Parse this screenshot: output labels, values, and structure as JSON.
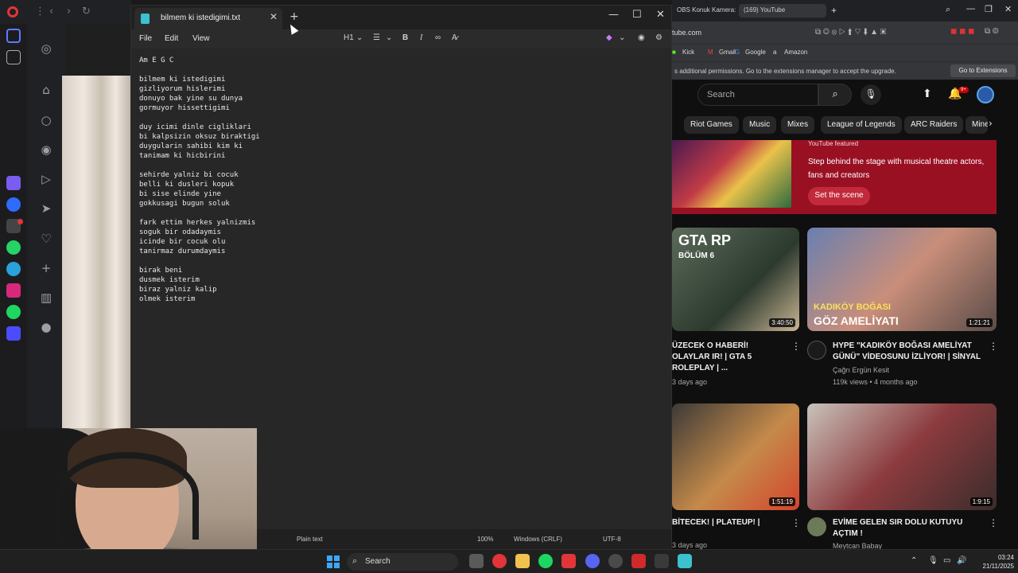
{
  "notepad": {
    "tab_title": "bilmem ki istedigimi.txt",
    "menu": {
      "file": "File",
      "edit": "Edit",
      "view": "View"
    },
    "toolbar": {
      "heading": "H1",
      "list_icon": "list-icon",
      "bold": "B",
      "italic": "I"
    },
    "lines": [
      "Am E G C",
      "",
      "bilmem ki istedigimi",
      "gizliyorum hislerimi",
      "donuyo bak yine su dunya",
      "gormuyor hissettigimi",
      "",
      "duy icimi dinle cigliklari",
      "bi kalpsizin oksuz biraktigi",
      "duygularin sahibi kim ki",
      "tanimam ki hicbirini",
      "",
      "sehirde yalniz bi cocuk",
      "belli ki dusleri kopuk",
      "bi sise elinde yine",
      "gokkusagi bugun soluk",
      "",
      "fark ettim herkes yalnizmis",
      "soguk bir odadaymis",
      "icinde bir cocuk olu",
      "tanirmaz durumdaymis",
      "",
      "birak beni",
      "dusmek isterim",
      "biraz yalniz kalip",
      "olmek isterim"
    ],
    "status": {
      "format": "Plain text",
      "zoom": "100%",
      "line_ending": "Windows (CRLF)",
      "encoding": "UTF-8"
    }
  },
  "browser": {
    "tabs": [
      "OBS Konuk Kamera:",
      "(169) YouTube"
    ],
    "address": "tube.com",
    "bookmarks": [
      "Kick",
      "Gmail",
      "Google",
      "Amazon"
    ],
    "infobar_text": "s additional permissions. Go to the extensions manager to accept the upgrade.",
    "infobar_button": "Go to Extensions"
  },
  "youtube": {
    "search_placeholder": "Search",
    "notif_badge": "9+",
    "chips": [
      "Riot Games",
      "Music",
      "Mixes",
      "League of Legends",
      "ARC Raiders",
      "Mine"
    ],
    "featured": {
      "label": "YouTube featured",
      "desc": "Step behind the stage with musical theatre actors, fans and creators",
      "button": "Set the scene"
    },
    "videos": [
      {
        "overlay1": "GTA RP",
        "overlay2": "BÖLÜM 6",
        "duration": "3:40:50",
        "title": "ÜZECEK O HABERİ! OLAYLAR IR! | GTA 5 ROLEPLAY | ...",
        "channel": "",
        "meta": "3 days ago"
      },
      {
        "overlay1": "KADIKÖY BOĞASI",
        "overlay2": "GÖZ AMELİYATI",
        "duration": "1:21:21",
        "title": "HYPE \"KADIKÖY BOĞASI AMELİYAT GÜNÜ\" VİDEOSUNU İZLİYOR! | SİNYAL",
        "channel": "Çağrı Ergün Kesit",
        "meta": "119k views • 4 months ago"
      },
      {
        "overlay1": "",
        "overlay2": "",
        "duration": "1:51:19",
        "title": "BİTECEK! | PLATEUP! |",
        "channel": "",
        "meta": "3 days ago"
      },
      {
        "overlay1": "",
        "overlay2": "",
        "duration": "1:9:15",
        "title": "EVİME GELEN SIR DOLU KUTUYU AÇTIM !",
        "channel": "Meytcan Babay",
        "meta": ""
      }
    ]
  },
  "taskbar": {
    "search_label": "Search",
    "time": "03:24",
    "date": "21/11/2025"
  }
}
